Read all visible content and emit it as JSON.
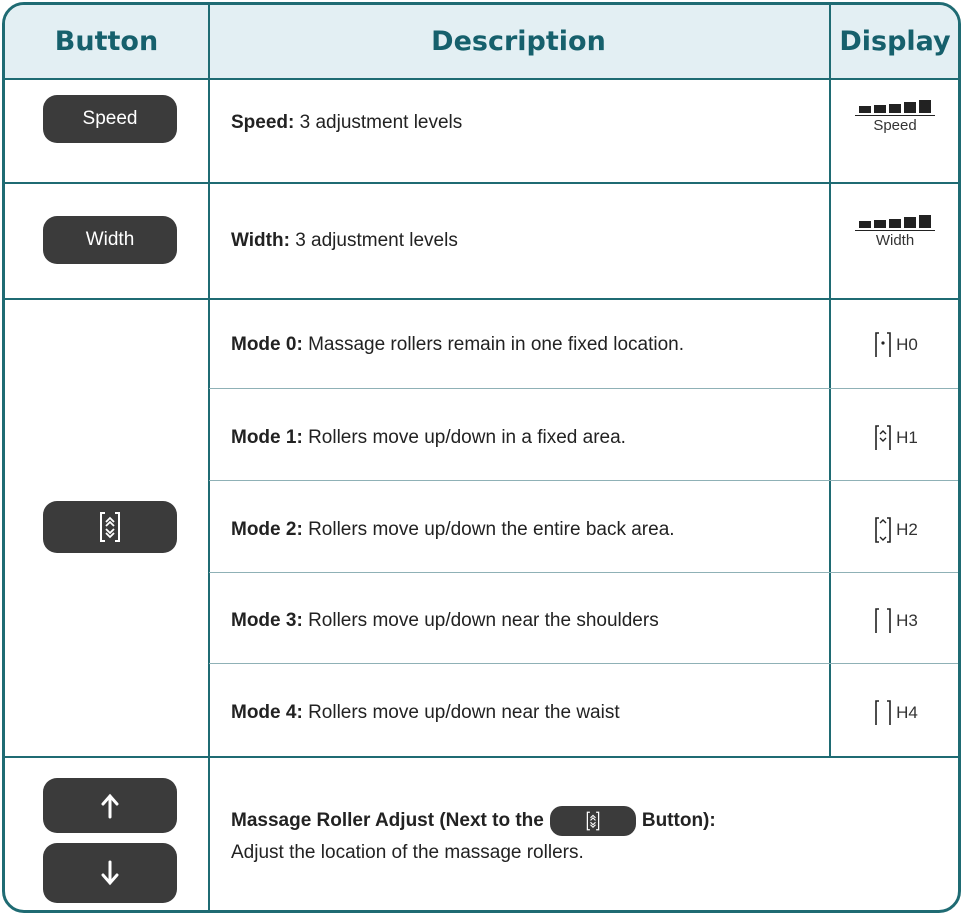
{
  "header": {
    "button": "Button",
    "description": "Description",
    "display": "Display"
  },
  "rows": {
    "speed": {
      "button_label": "Speed",
      "term": "Speed:",
      "text": "3 adjustment levels",
      "display_label": "Speed"
    },
    "width": {
      "button_label": "Width",
      "term": "Width:",
      "text": "3 adjustment levels",
      "display_label": "Width"
    },
    "modes": [
      {
        "term": "Mode 0:",
        "text": "Massage rollers remain in one fixed location.",
        "display": "H0"
      },
      {
        "term": "Mode 1:",
        "text": "Rollers move up/down in a fixed area.",
        "display": "H1"
      },
      {
        "term": "Mode 2:",
        "text": "Rollers move up/down the entire back area.",
        "display": "H2"
      },
      {
        "term": "Mode 3:",
        "text": "Rollers move up/down near the shoulders",
        "display": "H3"
      },
      {
        "term": "Mode 4:",
        "text": "Rollers move up/down near the waist",
        "display": "H4"
      }
    ],
    "adjust": {
      "term_before": "Massage Roller Adjust (Next to the",
      "term_after": "Button):",
      "text": "Adjust the location of the massage rollers."
    }
  },
  "icons": {
    "mode_button": "mode-cycle-icon",
    "up": "arrow-up-icon",
    "down": "arrow-down-icon",
    "level_bars": "level-bars-icon"
  },
  "colors": {
    "accent": "#1f6b73",
    "header_bg": "#e3eff3",
    "button_bg": "#3b3b3b"
  }
}
